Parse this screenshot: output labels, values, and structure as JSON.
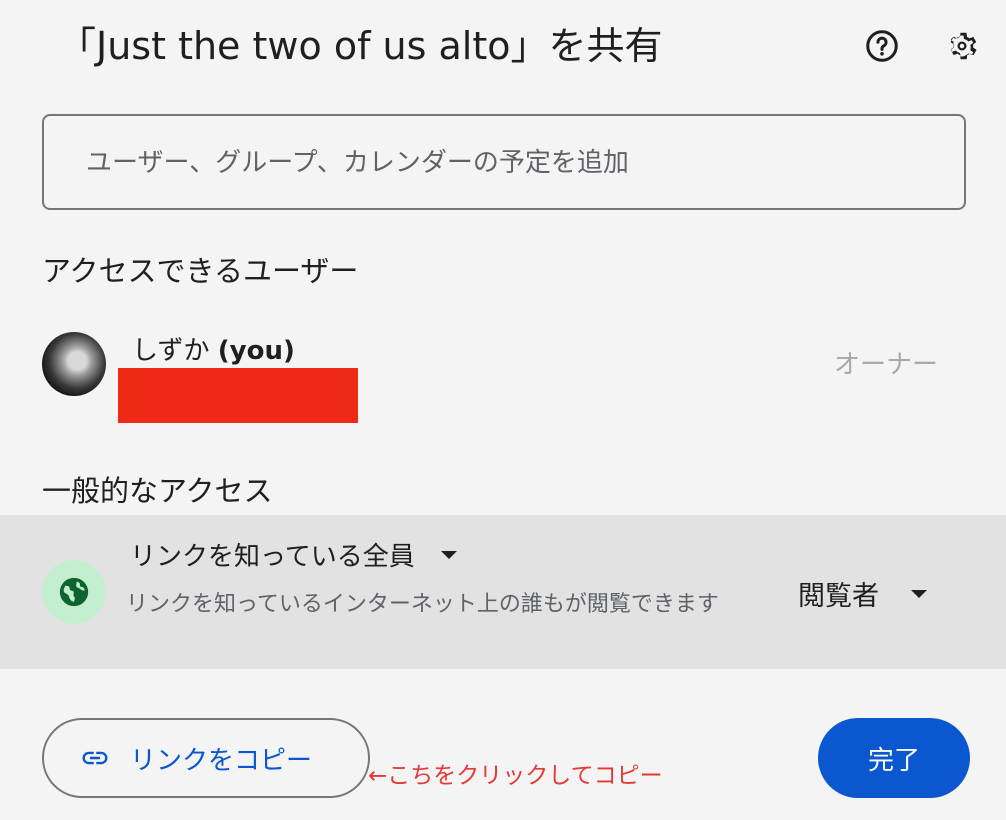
{
  "dialog": {
    "title": "「Just the two of us alto」を共有",
    "help_icon": "help-circle-icon",
    "settings_icon": "gear-icon"
  },
  "search": {
    "placeholder": "ユーザー、グループ、カレンダーの予定を追加",
    "value": ""
  },
  "access_section": {
    "heading": "アクセスできるユーザー",
    "users": [
      {
        "name": "しずか",
        "suffix": "(you)",
        "role": "オーナー"
      }
    ]
  },
  "general_access": {
    "heading": "一般的なアクセス",
    "scope": "リンクを知っている全員",
    "description": "リンクを知っているインターネット上の誰もが閲覧できます",
    "role": "閲覧者"
  },
  "footer": {
    "copy_link_label": "リンクをコピー",
    "annotation": "←こちをクリックしてコピー",
    "done_label": "完了"
  },
  "colors": {
    "accent": "#0b57d0",
    "redaction": "#ee2a16",
    "annotation": "#e53935",
    "globe_bg": "#c4eed0",
    "globe_fg": "#0d652d"
  }
}
